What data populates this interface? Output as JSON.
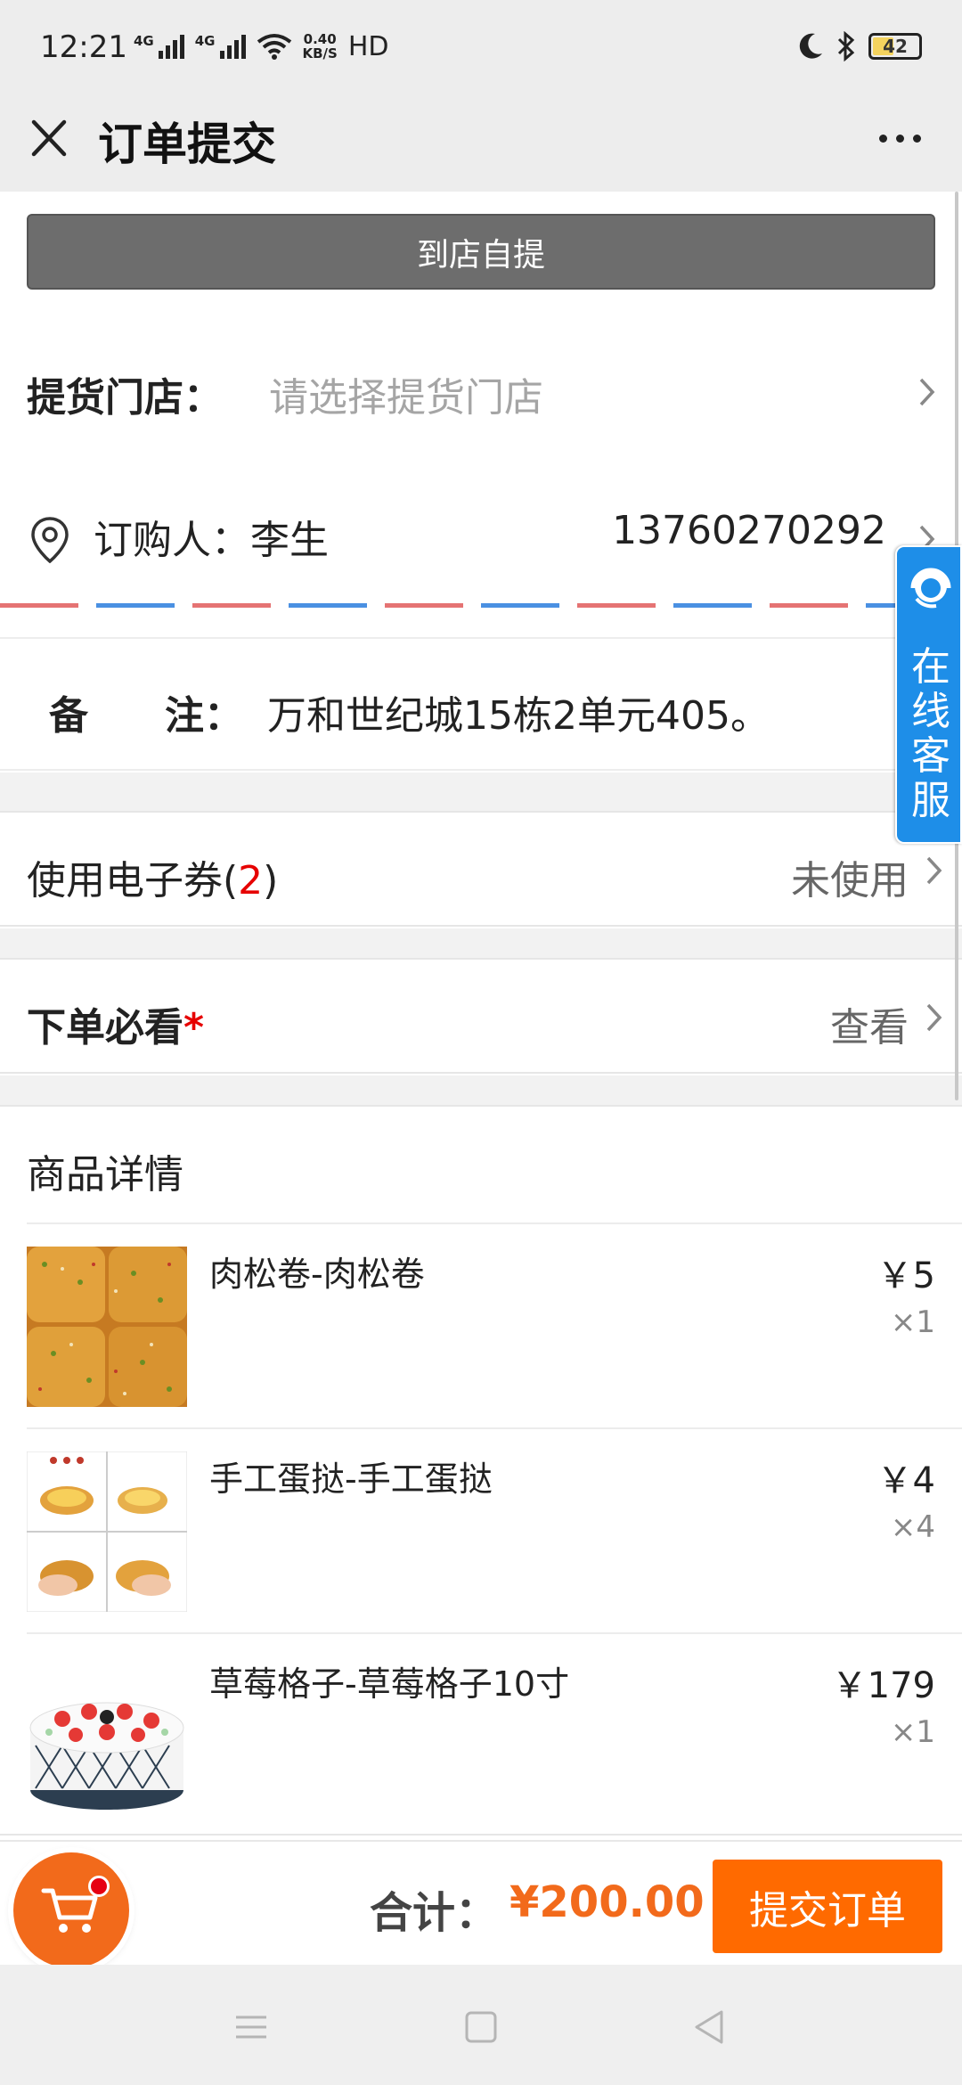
{
  "status_bar": {
    "time": "12:21",
    "net1": "4G",
    "net2": "4G",
    "speed_value": "0.40",
    "speed_unit": "KB/S",
    "hd": "HD",
    "battery": "42"
  },
  "header": {
    "title": "订单提交"
  },
  "pickup": {
    "button_label": "到店自提",
    "store_label": "提货门店：",
    "store_placeholder": "请选择提货门店"
  },
  "buyer": {
    "label": "订购人：李生",
    "phone": "13760270292"
  },
  "remark": {
    "key_part1": "备",
    "key_part2": "注：",
    "value": "万和世纪城15栋2单元405。"
  },
  "coupon": {
    "label_prefix": "使用电子券(",
    "count": "2",
    "label_suffix": ")",
    "status": "未使用"
  },
  "notice": {
    "label": "下单必看",
    "required_mark": "*",
    "action": "查看"
  },
  "products": {
    "header": "商品详情",
    "items": [
      {
        "name": "肉松卷-肉松卷",
        "price": "￥5",
        "qty": "×1"
      },
      {
        "name": "手工蛋挞-手工蛋挞",
        "price": "￥4",
        "qty": "×4"
      },
      {
        "name": "草莓格子-草莓格子10寸",
        "price": "￥179",
        "qty": "×1"
      }
    ]
  },
  "footer": {
    "total_label": "合计：",
    "total_value": "¥200.00",
    "submit_label": "提交订单"
  },
  "service": {
    "label": "在线客服"
  },
  "colors": {
    "accent_orange": "#ff6a00",
    "price_orange": "#f26a1b",
    "required_red": "#e60000",
    "service_blue": "#1e8ee8",
    "stripe_red": "#e57373",
    "stripe_blue": "#4a90e2"
  }
}
